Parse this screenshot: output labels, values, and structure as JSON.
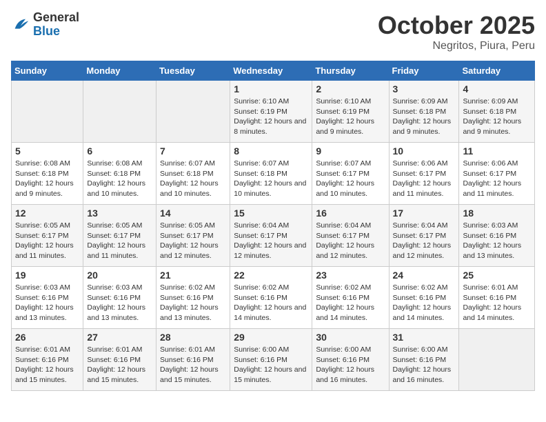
{
  "header": {
    "logo_general": "General",
    "logo_blue": "Blue",
    "month": "October 2025",
    "location": "Negritos, Piura, Peru"
  },
  "weekdays": [
    "Sunday",
    "Monday",
    "Tuesday",
    "Wednesday",
    "Thursday",
    "Friday",
    "Saturday"
  ],
  "weeks": [
    [
      {
        "day": "",
        "sunrise": "",
        "sunset": "",
        "daylight": ""
      },
      {
        "day": "",
        "sunrise": "",
        "sunset": "",
        "daylight": ""
      },
      {
        "day": "",
        "sunrise": "",
        "sunset": "",
        "daylight": ""
      },
      {
        "day": "1",
        "sunrise": "Sunrise: 6:10 AM",
        "sunset": "Sunset: 6:19 PM",
        "daylight": "Daylight: 12 hours and 8 minutes."
      },
      {
        "day": "2",
        "sunrise": "Sunrise: 6:10 AM",
        "sunset": "Sunset: 6:19 PM",
        "daylight": "Daylight: 12 hours and 9 minutes."
      },
      {
        "day": "3",
        "sunrise": "Sunrise: 6:09 AM",
        "sunset": "Sunset: 6:18 PM",
        "daylight": "Daylight: 12 hours and 9 minutes."
      },
      {
        "day": "4",
        "sunrise": "Sunrise: 6:09 AM",
        "sunset": "Sunset: 6:18 PM",
        "daylight": "Daylight: 12 hours and 9 minutes."
      }
    ],
    [
      {
        "day": "5",
        "sunrise": "Sunrise: 6:08 AM",
        "sunset": "Sunset: 6:18 PM",
        "daylight": "Daylight: 12 hours and 9 minutes."
      },
      {
        "day": "6",
        "sunrise": "Sunrise: 6:08 AM",
        "sunset": "Sunset: 6:18 PM",
        "daylight": "Daylight: 12 hours and 10 minutes."
      },
      {
        "day": "7",
        "sunrise": "Sunrise: 6:07 AM",
        "sunset": "Sunset: 6:18 PM",
        "daylight": "Daylight: 12 hours and 10 minutes."
      },
      {
        "day": "8",
        "sunrise": "Sunrise: 6:07 AM",
        "sunset": "Sunset: 6:18 PM",
        "daylight": "Daylight: 12 hours and 10 minutes."
      },
      {
        "day": "9",
        "sunrise": "Sunrise: 6:07 AM",
        "sunset": "Sunset: 6:17 PM",
        "daylight": "Daylight: 12 hours and 10 minutes."
      },
      {
        "day": "10",
        "sunrise": "Sunrise: 6:06 AM",
        "sunset": "Sunset: 6:17 PM",
        "daylight": "Daylight: 12 hours and 11 minutes."
      },
      {
        "day": "11",
        "sunrise": "Sunrise: 6:06 AM",
        "sunset": "Sunset: 6:17 PM",
        "daylight": "Daylight: 12 hours and 11 minutes."
      }
    ],
    [
      {
        "day": "12",
        "sunrise": "Sunrise: 6:05 AM",
        "sunset": "Sunset: 6:17 PM",
        "daylight": "Daylight: 12 hours and 11 minutes."
      },
      {
        "day": "13",
        "sunrise": "Sunrise: 6:05 AM",
        "sunset": "Sunset: 6:17 PM",
        "daylight": "Daylight: 12 hours and 11 minutes."
      },
      {
        "day": "14",
        "sunrise": "Sunrise: 6:05 AM",
        "sunset": "Sunset: 6:17 PM",
        "daylight": "Daylight: 12 hours and 12 minutes."
      },
      {
        "day": "15",
        "sunrise": "Sunrise: 6:04 AM",
        "sunset": "Sunset: 6:17 PM",
        "daylight": "Daylight: 12 hours and 12 minutes."
      },
      {
        "day": "16",
        "sunrise": "Sunrise: 6:04 AM",
        "sunset": "Sunset: 6:17 PM",
        "daylight": "Daylight: 12 hours and 12 minutes."
      },
      {
        "day": "17",
        "sunrise": "Sunrise: 6:04 AM",
        "sunset": "Sunset: 6:17 PM",
        "daylight": "Daylight: 12 hours and 12 minutes."
      },
      {
        "day": "18",
        "sunrise": "Sunrise: 6:03 AM",
        "sunset": "Sunset: 6:16 PM",
        "daylight": "Daylight: 12 hours and 13 minutes."
      }
    ],
    [
      {
        "day": "19",
        "sunrise": "Sunrise: 6:03 AM",
        "sunset": "Sunset: 6:16 PM",
        "daylight": "Daylight: 12 hours and 13 minutes."
      },
      {
        "day": "20",
        "sunrise": "Sunrise: 6:03 AM",
        "sunset": "Sunset: 6:16 PM",
        "daylight": "Daylight: 12 hours and 13 minutes."
      },
      {
        "day": "21",
        "sunrise": "Sunrise: 6:02 AM",
        "sunset": "Sunset: 6:16 PM",
        "daylight": "Daylight: 12 hours and 13 minutes."
      },
      {
        "day": "22",
        "sunrise": "Sunrise: 6:02 AM",
        "sunset": "Sunset: 6:16 PM",
        "daylight": "Daylight: 12 hours and 14 minutes."
      },
      {
        "day": "23",
        "sunrise": "Sunrise: 6:02 AM",
        "sunset": "Sunset: 6:16 PM",
        "daylight": "Daylight: 12 hours and 14 minutes."
      },
      {
        "day": "24",
        "sunrise": "Sunrise: 6:02 AM",
        "sunset": "Sunset: 6:16 PM",
        "daylight": "Daylight: 12 hours and 14 minutes."
      },
      {
        "day": "25",
        "sunrise": "Sunrise: 6:01 AM",
        "sunset": "Sunset: 6:16 PM",
        "daylight": "Daylight: 12 hours and 14 minutes."
      }
    ],
    [
      {
        "day": "26",
        "sunrise": "Sunrise: 6:01 AM",
        "sunset": "Sunset: 6:16 PM",
        "daylight": "Daylight: 12 hours and 15 minutes."
      },
      {
        "day": "27",
        "sunrise": "Sunrise: 6:01 AM",
        "sunset": "Sunset: 6:16 PM",
        "daylight": "Daylight: 12 hours and 15 minutes."
      },
      {
        "day": "28",
        "sunrise": "Sunrise: 6:01 AM",
        "sunset": "Sunset: 6:16 PM",
        "daylight": "Daylight: 12 hours and 15 minutes."
      },
      {
        "day": "29",
        "sunrise": "Sunrise: 6:00 AM",
        "sunset": "Sunset: 6:16 PM",
        "daylight": "Daylight: 12 hours and 15 minutes."
      },
      {
        "day": "30",
        "sunrise": "Sunrise: 6:00 AM",
        "sunset": "Sunset: 6:16 PM",
        "daylight": "Daylight: 12 hours and 16 minutes."
      },
      {
        "day": "31",
        "sunrise": "Sunrise: 6:00 AM",
        "sunset": "Sunset: 6:16 PM",
        "daylight": "Daylight: 12 hours and 16 minutes."
      },
      {
        "day": "",
        "sunrise": "",
        "sunset": "",
        "daylight": ""
      }
    ]
  ]
}
